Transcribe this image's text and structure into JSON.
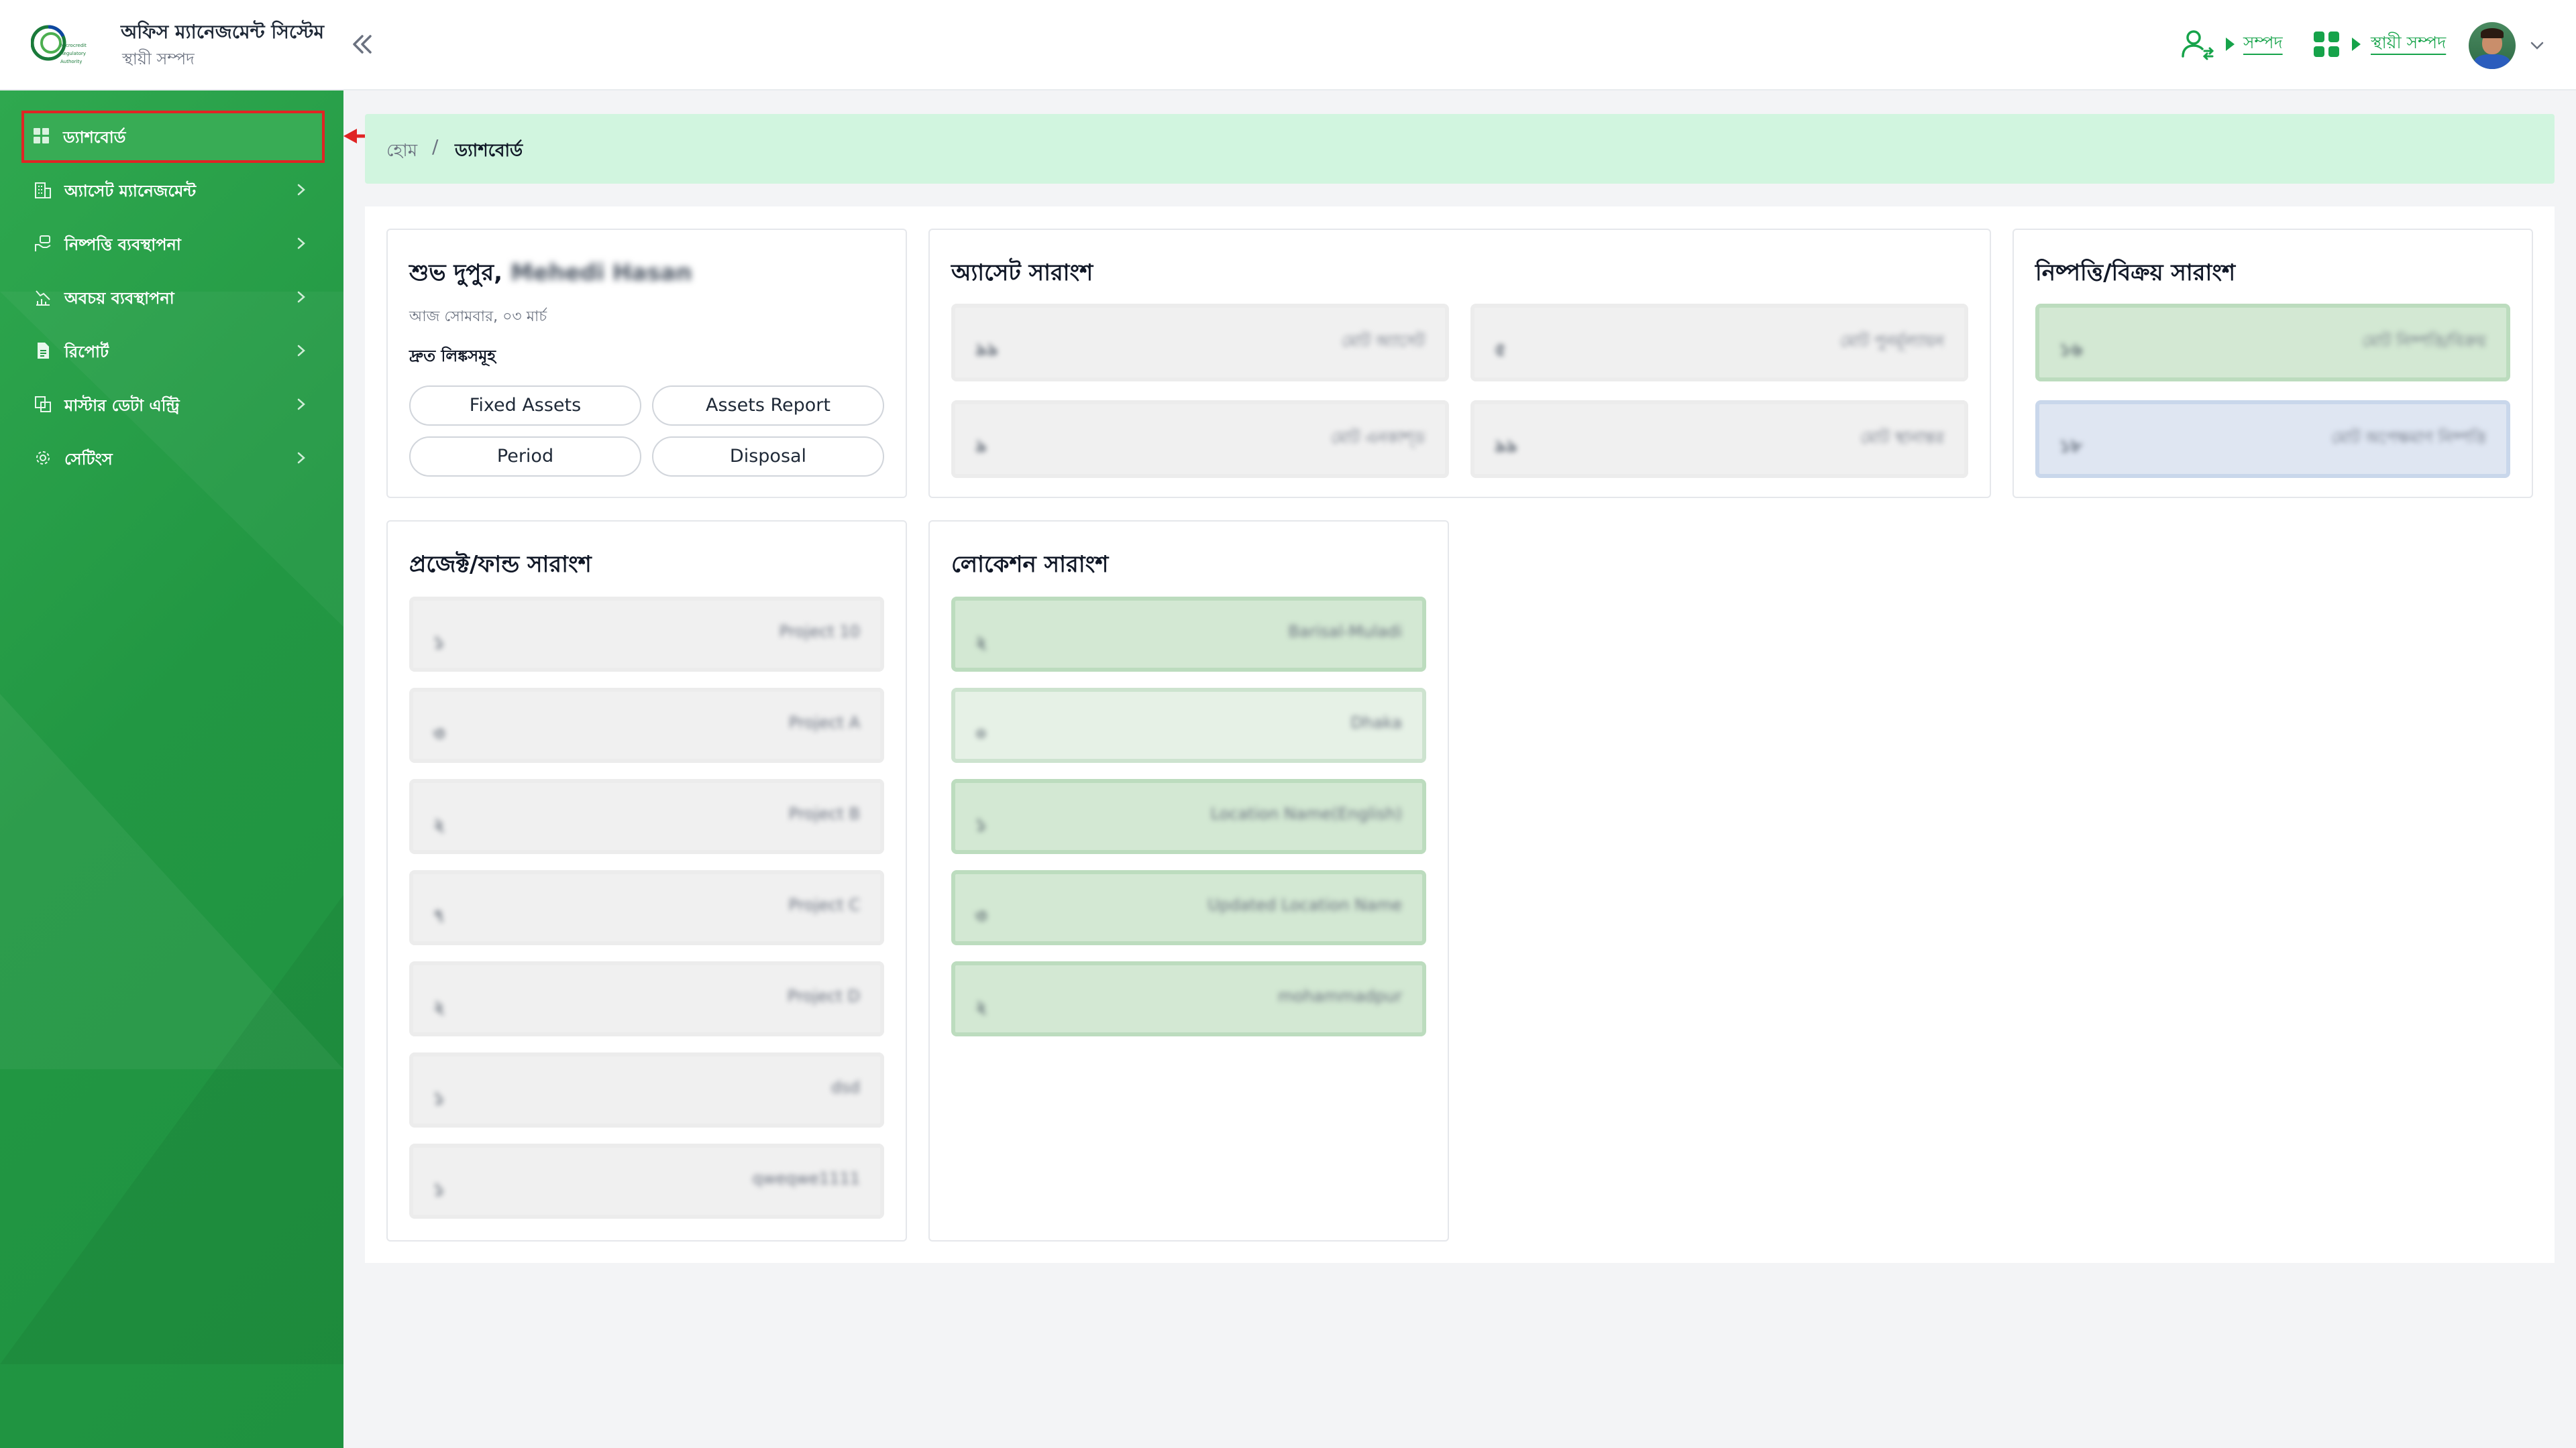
{
  "header": {
    "app_title": "অফিস ম্যানেজমেন্ট সিস্টেম",
    "app_subtitle": "স্থায়ী সম্পদ",
    "logo_text": "Microcredit Regulatory Authority",
    "link_1": "সম্পদ",
    "link_2": "স্থায়ী সম্পদ",
    "brand_color": "#16a34a"
  },
  "sidebar": {
    "items": [
      {
        "label": "ড্যাশবোর্ড",
        "icon": "dashboard-grid-icon",
        "active": true
      },
      {
        "label": "অ্যাসেট ম্যানেজমেন্ট",
        "icon": "building-icon"
      },
      {
        "label": "নিষ্পত্তি ব্যবস্থাপনা",
        "icon": "hand-money-icon"
      },
      {
        "label": "অবচয় ব্যবস্থাপনা",
        "icon": "chart-down-icon"
      },
      {
        "label": "রিপোর্ট",
        "icon": "document-icon"
      },
      {
        "label": "মাস্টার ডেটা এন্ট্রি",
        "icon": "data-entry-icon"
      },
      {
        "label": "সেটিংস",
        "icon": "gear-icon"
      }
    ],
    "background": "#229743",
    "active_outline_color": "#e02424"
  },
  "breadcrumb": {
    "home": "হোম",
    "separator": "/",
    "current": "ড্যাশবোর্ড"
  },
  "greeting_card": {
    "greeting": "শুভ দুপুর,",
    "user_name": "Mehedi Hasan",
    "date": "আজ সোমবার, ০৩ মার্চ",
    "quick_links_title": "দ্রুত লিঙ্কসমূহ",
    "quick_links": [
      "Fixed Assets",
      "Assets Report",
      "Period",
      "Disposal"
    ]
  },
  "asset_summary": {
    "title": "অ্যাসেট সারাংশ",
    "tiles": [
      {
        "value": "৯৯",
        "label": "মোট অ্যাসেট"
      },
      {
        "value": "৫",
        "label": "মোট পুনর্মূল্যায়ন"
      },
      {
        "value": "৯",
        "label": "মোট এনকাশ্ড"
      },
      {
        "value": "৯৯",
        "label": "মোট স্থানান্তর"
      }
    ]
  },
  "disposal_summary": {
    "title": "নিষ্পত্তি/বিক্রয় সারাংশ",
    "tiles": [
      {
        "value": "১৬",
        "label": "মোট নিষ্পত্তি/বিক্রয়"
      },
      {
        "value": "১৮",
        "label": "মোট অপেক্ষমাণ নিষ্পত্তি"
      }
    ]
  },
  "project_summary": {
    "title": "প্রজেক্ট/ফান্ড সারাংশ",
    "rows": [
      {
        "value": "১",
        "label": "Project 10"
      },
      {
        "value": "৩",
        "label": "Project A"
      },
      {
        "value": "২",
        "label": "Project B"
      },
      {
        "value": "৭",
        "label": "Project C"
      },
      {
        "value": "২",
        "label": "Project D"
      },
      {
        "value": "১",
        "label": "dsd"
      },
      {
        "value": "১",
        "label": "qweqwe1111"
      }
    ]
  },
  "location_summary": {
    "title": "লোকেশন সারাংশ",
    "rows": [
      {
        "value": "২",
        "label": "Barisal-Muladi"
      },
      {
        "value": "০",
        "label": "Dhaka"
      },
      {
        "value": "১",
        "label": "Location Name(English)"
      },
      {
        "value": "৩",
        "label": "Updated Location Name"
      },
      {
        "value": "২",
        "label": "mohammadpur"
      }
    ]
  }
}
